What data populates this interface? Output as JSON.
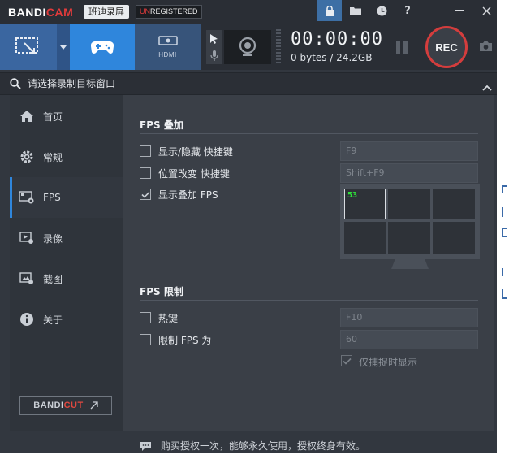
{
  "titlebar": {
    "brand_a": "BANDI",
    "brand_b": "CAM",
    "subtitle": "班迪录屏",
    "reg_un": "UN",
    "reg_rest": "REGISTERED",
    "icons": [
      "lock-icon",
      "folder-icon",
      "clock-icon",
      "help-icon",
      "minimize-icon",
      "close-icon"
    ]
  },
  "toolbar": {
    "modes": [
      "rectangle-mode",
      "game-mode",
      "hdmi-mode"
    ],
    "hdmi_label": "HDMI",
    "timer": "00:00:00",
    "bytes": "0 bytes / 24.2GB",
    "rec_label": "REC"
  },
  "target": {
    "label": "请选择录制目标窗口"
  },
  "sidebar": {
    "items": [
      {
        "label": "首页",
        "icon": "home-icon"
      },
      {
        "label": "常规",
        "icon": "gear-icon"
      },
      {
        "label": "FPS",
        "icon": "fps-icon"
      },
      {
        "label": "录像",
        "icon": "video-icon"
      },
      {
        "label": "截图",
        "icon": "image-icon"
      },
      {
        "label": "关于",
        "icon": "info-icon"
      }
    ],
    "bandicut_a": "BANDI",
    "bandicut_b": "CUT"
  },
  "fps_overlay": {
    "title": "FPS 叠加",
    "options": [
      {
        "label": "显示/隐藏 快捷键",
        "checked": false,
        "hotkey": "F9"
      },
      {
        "label": "位置改变 快捷键",
        "checked": false,
        "hotkey": "Shift+F9"
      },
      {
        "label": "显示叠加 FPS",
        "checked": true
      }
    ],
    "preview_fps": "53"
  },
  "fps_limit": {
    "title": "FPS 限制",
    "options": [
      {
        "label": "热键",
        "checked": false,
        "hotkey": "F10"
      },
      {
        "label": "限制 FPS 为",
        "checked": false,
        "value": "60"
      }
    ],
    "only_when_capturing": {
      "label": "仅捕捉时显示",
      "checked": true
    }
  },
  "footer": {
    "text": "购买授权一次，能够永久使用，授权终身有效。"
  },
  "colors": {
    "accent": "#2f86dc",
    "rec": "#d43d3d",
    "fps_green": "#2fe03a"
  }
}
